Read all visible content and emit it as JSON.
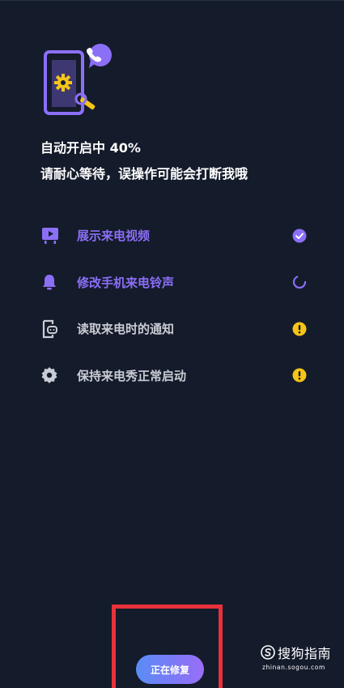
{
  "status": {
    "progress_text": "自动开启中 40%",
    "hint_text": "请耐心等待，误操作可能会打断我哦"
  },
  "tasks": [
    {
      "label": "展示来电视频",
      "icon": "video-icon",
      "state": "done",
      "state_icon": "check-circle-icon"
    },
    {
      "label": "修改手机来电铃声",
      "icon": "bell-icon",
      "state": "in-progress",
      "state_icon": "spinner-icon"
    },
    {
      "label": "读取来电时的通知",
      "icon": "notification-icon",
      "state": "warning",
      "state_icon": "warning-icon"
    },
    {
      "label": "保持来电秀正常启动",
      "icon": "gear-icon",
      "state": "warning",
      "state_icon": "warning-icon"
    }
  ],
  "repair_button": {
    "label": "正在修复"
  },
  "watermark": {
    "name": "搜狗指南",
    "domain": "zhinan.sogou.com"
  },
  "colors": {
    "background": "#141b2b",
    "accent_purple": "#8b6ff7",
    "warning_yellow": "#f5c518",
    "inactive_text": "#c9ccd4",
    "annotation_red": "#e8323b"
  }
}
